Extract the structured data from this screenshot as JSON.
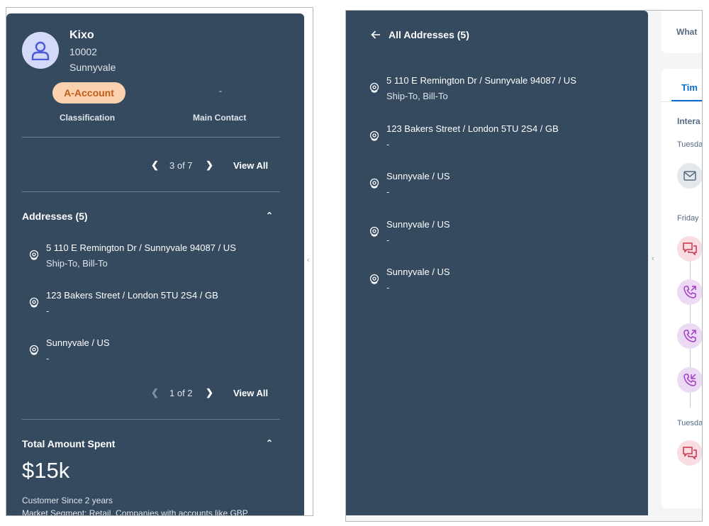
{
  "left": {
    "name": "Kixo",
    "id": "10002",
    "city": "Sunnyvale",
    "classification_value": "A-Account",
    "classification_label": "Classification",
    "main_contact_value": "-",
    "main_contact_label": "Main Contact",
    "pager1": "3 of 7",
    "view_all": "View All",
    "addresses_title": "Addresses (5)",
    "addresses": [
      {
        "line1": "5 110 E Remington Dr / Sunnyvale 94087 / US",
        "line2": "Ship-To, Bill-To"
      },
      {
        "line1": "123 Bakers Street / London 5TU 2S4 / GB",
        "line2": "-"
      },
      {
        "line1": "Sunnyvale / US",
        "line2": "-"
      }
    ],
    "pager2": "1 of 2",
    "total_title": "Total Amount Spent",
    "amount": "$15k",
    "customer_since": "Customer Since 2 years",
    "cutoff_text": "Market Segment: Retail, Companies with accounts like GBP"
  },
  "right": {
    "title": "All Addresses (5)",
    "addresses": [
      {
        "line1": "5 110 E Remington Dr / Sunnyvale 94087 / US",
        "line2": "Ship-To, Bill-To"
      },
      {
        "line1": "123 Bakers Street / London 5TU 2S4 / GB",
        "line2": "-"
      },
      {
        "line1": "Sunnyvale / US",
        "line2": "-"
      },
      {
        "line1": "Sunnyvale / US",
        "line2": "-"
      },
      {
        "line1": "Sunnyvale / US",
        "line2": "-"
      }
    ],
    "peek": {
      "search": "What",
      "tab": "Tim",
      "interactions": "Intera",
      "day1": "Tuesda",
      "day2": "Friday",
      "day3": "Tuesda"
    }
  },
  "colors": {
    "panel": "#354a5f",
    "badge_bg": "#fbd2b0",
    "badge_text": "#c05b19",
    "accent": "#0a6ed1"
  },
  "icons": [
    "person-icon",
    "location-pin-icon",
    "chevron-left-icon",
    "chevron-right-icon",
    "chevron-up-icon",
    "back-arrow-icon",
    "mail-icon",
    "chat-icon",
    "phone-icon"
  ]
}
